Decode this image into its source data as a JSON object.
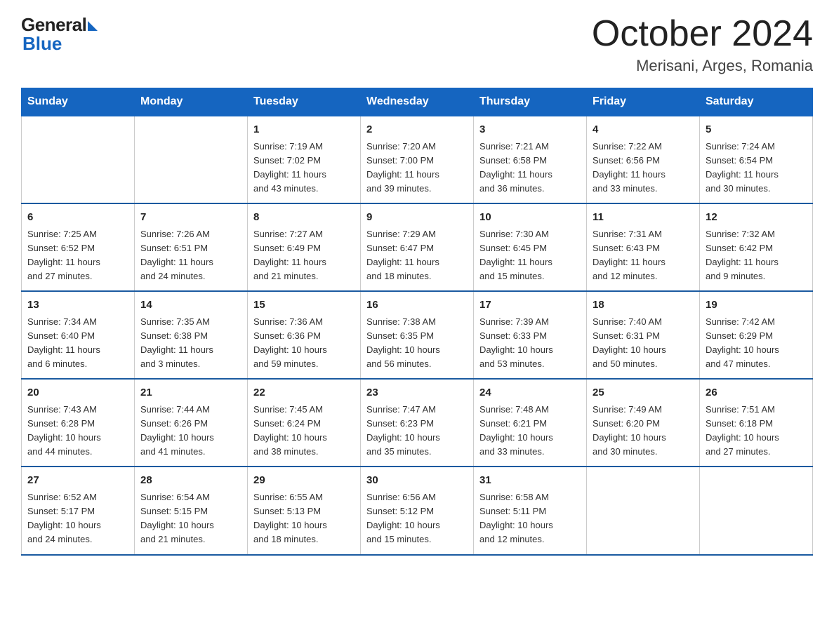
{
  "header": {
    "logo_general": "General",
    "logo_blue": "Blue",
    "title": "October 2024",
    "location": "Merisani, Arges, Romania"
  },
  "days_of_week": [
    "Sunday",
    "Monday",
    "Tuesday",
    "Wednesday",
    "Thursday",
    "Friday",
    "Saturday"
  ],
  "weeks": [
    [
      {
        "day": "",
        "info": ""
      },
      {
        "day": "",
        "info": ""
      },
      {
        "day": "1",
        "info": "Sunrise: 7:19 AM\nSunset: 7:02 PM\nDaylight: 11 hours\nand 43 minutes."
      },
      {
        "day": "2",
        "info": "Sunrise: 7:20 AM\nSunset: 7:00 PM\nDaylight: 11 hours\nand 39 minutes."
      },
      {
        "day": "3",
        "info": "Sunrise: 7:21 AM\nSunset: 6:58 PM\nDaylight: 11 hours\nand 36 minutes."
      },
      {
        "day": "4",
        "info": "Sunrise: 7:22 AM\nSunset: 6:56 PM\nDaylight: 11 hours\nand 33 minutes."
      },
      {
        "day": "5",
        "info": "Sunrise: 7:24 AM\nSunset: 6:54 PM\nDaylight: 11 hours\nand 30 minutes."
      }
    ],
    [
      {
        "day": "6",
        "info": "Sunrise: 7:25 AM\nSunset: 6:52 PM\nDaylight: 11 hours\nand 27 minutes."
      },
      {
        "day": "7",
        "info": "Sunrise: 7:26 AM\nSunset: 6:51 PM\nDaylight: 11 hours\nand 24 minutes."
      },
      {
        "day": "8",
        "info": "Sunrise: 7:27 AM\nSunset: 6:49 PM\nDaylight: 11 hours\nand 21 minutes."
      },
      {
        "day": "9",
        "info": "Sunrise: 7:29 AM\nSunset: 6:47 PM\nDaylight: 11 hours\nand 18 minutes."
      },
      {
        "day": "10",
        "info": "Sunrise: 7:30 AM\nSunset: 6:45 PM\nDaylight: 11 hours\nand 15 minutes."
      },
      {
        "day": "11",
        "info": "Sunrise: 7:31 AM\nSunset: 6:43 PM\nDaylight: 11 hours\nand 12 minutes."
      },
      {
        "day": "12",
        "info": "Sunrise: 7:32 AM\nSunset: 6:42 PM\nDaylight: 11 hours\nand 9 minutes."
      }
    ],
    [
      {
        "day": "13",
        "info": "Sunrise: 7:34 AM\nSunset: 6:40 PM\nDaylight: 11 hours\nand 6 minutes."
      },
      {
        "day": "14",
        "info": "Sunrise: 7:35 AM\nSunset: 6:38 PM\nDaylight: 11 hours\nand 3 minutes."
      },
      {
        "day": "15",
        "info": "Sunrise: 7:36 AM\nSunset: 6:36 PM\nDaylight: 10 hours\nand 59 minutes."
      },
      {
        "day": "16",
        "info": "Sunrise: 7:38 AM\nSunset: 6:35 PM\nDaylight: 10 hours\nand 56 minutes."
      },
      {
        "day": "17",
        "info": "Sunrise: 7:39 AM\nSunset: 6:33 PM\nDaylight: 10 hours\nand 53 minutes."
      },
      {
        "day": "18",
        "info": "Sunrise: 7:40 AM\nSunset: 6:31 PM\nDaylight: 10 hours\nand 50 minutes."
      },
      {
        "day": "19",
        "info": "Sunrise: 7:42 AM\nSunset: 6:29 PM\nDaylight: 10 hours\nand 47 minutes."
      }
    ],
    [
      {
        "day": "20",
        "info": "Sunrise: 7:43 AM\nSunset: 6:28 PM\nDaylight: 10 hours\nand 44 minutes."
      },
      {
        "day": "21",
        "info": "Sunrise: 7:44 AM\nSunset: 6:26 PM\nDaylight: 10 hours\nand 41 minutes."
      },
      {
        "day": "22",
        "info": "Sunrise: 7:45 AM\nSunset: 6:24 PM\nDaylight: 10 hours\nand 38 minutes."
      },
      {
        "day": "23",
        "info": "Sunrise: 7:47 AM\nSunset: 6:23 PM\nDaylight: 10 hours\nand 35 minutes."
      },
      {
        "day": "24",
        "info": "Sunrise: 7:48 AM\nSunset: 6:21 PM\nDaylight: 10 hours\nand 33 minutes."
      },
      {
        "day": "25",
        "info": "Sunrise: 7:49 AM\nSunset: 6:20 PM\nDaylight: 10 hours\nand 30 minutes."
      },
      {
        "day": "26",
        "info": "Sunrise: 7:51 AM\nSunset: 6:18 PM\nDaylight: 10 hours\nand 27 minutes."
      }
    ],
    [
      {
        "day": "27",
        "info": "Sunrise: 6:52 AM\nSunset: 5:17 PM\nDaylight: 10 hours\nand 24 minutes."
      },
      {
        "day": "28",
        "info": "Sunrise: 6:54 AM\nSunset: 5:15 PM\nDaylight: 10 hours\nand 21 minutes."
      },
      {
        "day": "29",
        "info": "Sunrise: 6:55 AM\nSunset: 5:13 PM\nDaylight: 10 hours\nand 18 minutes."
      },
      {
        "day": "30",
        "info": "Sunrise: 6:56 AM\nSunset: 5:12 PM\nDaylight: 10 hours\nand 15 minutes."
      },
      {
        "day": "31",
        "info": "Sunrise: 6:58 AM\nSunset: 5:11 PM\nDaylight: 10 hours\nand 12 minutes."
      },
      {
        "day": "",
        "info": ""
      },
      {
        "day": "",
        "info": ""
      }
    ]
  ]
}
